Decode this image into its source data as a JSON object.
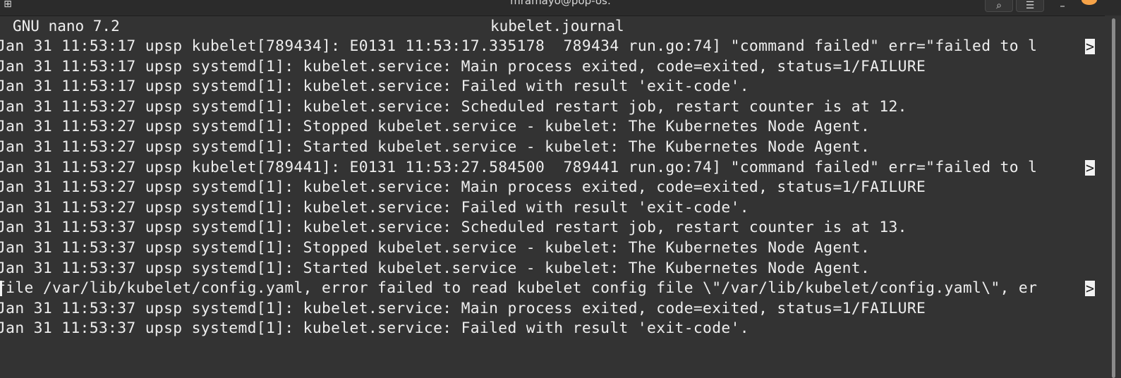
{
  "window": {
    "title": "mramayo@pop-os:",
    "app_icon": "terminal-icon",
    "controls": {
      "search_icon": "search-icon",
      "menu_icon": "hamburger-menu-icon",
      "minimize_icon": "minimize-icon",
      "close_icon": "close-icon"
    }
  },
  "nano": {
    "version": "GNU nano 7.2",
    "filename": "kubelet.journal",
    "overflow_marker": ">"
  },
  "lines": [
    {
      "text": "Jan 31 11:53:17 upsp kubelet[789434]: E0131 11:53:17.335178  789434 run.go:74] \"command failed\" err=\"failed to l",
      "truncated": true
    },
    {
      "text": "Jan 31 11:53:17 upsp systemd[1]: kubelet.service: Main process exited, code=exited, status=1/FAILURE",
      "truncated": false
    },
    {
      "text": "Jan 31 11:53:17 upsp systemd[1]: kubelet.service: Failed with result 'exit-code'.",
      "truncated": false
    },
    {
      "text": "Jan 31 11:53:27 upsp systemd[1]: kubelet.service: Scheduled restart job, restart counter is at 12.",
      "truncated": false
    },
    {
      "text": "Jan 31 11:53:27 upsp systemd[1]: Stopped kubelet.service - kubelet: The Kubernetes Node Agent.",
      "truncated": false
    },
    {
      "text": "Jan 31 11:53:27 upsp systemd[1]: Started kubelet.service - kubelet: The Kubernetes Node Agent.",
      "truncated": false
    },
    {
      "text": "Jan 31 11:53:27 upsp kubelet[789441]: E0131 11:53:27.584500  789441 run.go:74] \"command failed\" err=\"failed to l",
      "truncated": true
    },
    {
      "text": "Jan 31 11:53:27 upsp systemd[1]: kubelet.service: Main process exited, code=exited, status=1/FAILURE",
      "truncated": false
    },
    {
      "text": "Jan 31 11:53:27 upsp systemd[1]: kubelet.service: Failed with result 'exit-code'.",
      "truncated": false
    },
    {
      "text": "Jan 31 11:53:37 upsp systemd[1]: kubelet.service: Scheduled restart job, restart counter is at 13.",
      "truncated": false
    },
    {
      "text": "Jan 31 11:53:37 upsp systemd[1]: Stopped kubelet.service - kubelet: The Kubernetes Node Agent.",
      "truncated": false
    },
    {
      "text": "Jan 31 11:53:37 upsp systemd[1]: Started kubelet.service - kubelet: The Kubernetes Node Agent.",
      "truncated": false
    },
    {
      "text": "file /var/lib/kubelet/config.yaml, error failed to read kubelet config file \\\"/var/lib/kubelet/config.yaml\\\", er",
      "truncated": true,
      "cursor": true
    },
    {
      "text": "Jan 31 11:53:37 upsp systemd[1]: kubelet.service: Main process exited, code=exited, status=1/FAILURE",
      "truncated": false
    },
    {
      "text": "Jan 31 11:53:37 upsp systemd[1]: kubelet.service: Failed with result 'exit-code'.",
      "truncated": false
    }
  ]
}
